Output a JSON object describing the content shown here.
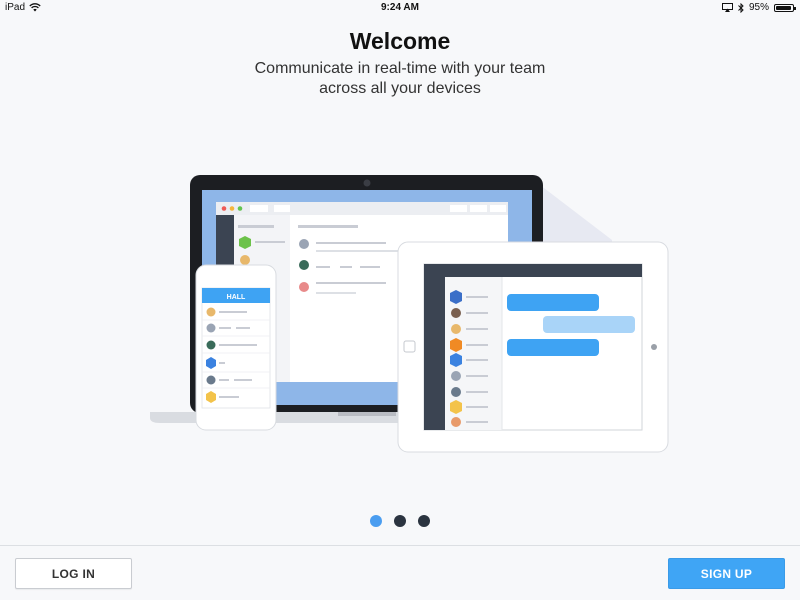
{
  "status_bar": {
    "device": "iPad",
    "time": "9:24 AM",
    "battery": "95%",
    "battery_level": 0.95,
    "icons": [
      "wifi-icon",
      "screen-mirror-icon",
      "bluetooth-icon",
      "battery-icon"
    ]
  },
  "onboarding": {
    "title": "Welcome",
    "subtitle": "Communicate in real-time with your team across all your devices",
    "page_index": 0,
    "page_count": 3
  },
  "illustration": {
    "phone_header": "HALL"
  },
  "colors": {
    "accent": "#3fa5f5",
    "dot_active": "#4a9df0",
    "dot_inactive": "#2b3440",
    "chat_bubble": "#3ea3f3",
    "avatar_green": "#6cc24a",
    "avatar_blue": "#3b82e0",
    "avatar_orange": "#f08a24",
    "avatar_yellow": "#f3c34a"
  },
  "actions": {
    "login_label": "LOG IN",
    "signup_label": "SIGN UP"
  }
}
